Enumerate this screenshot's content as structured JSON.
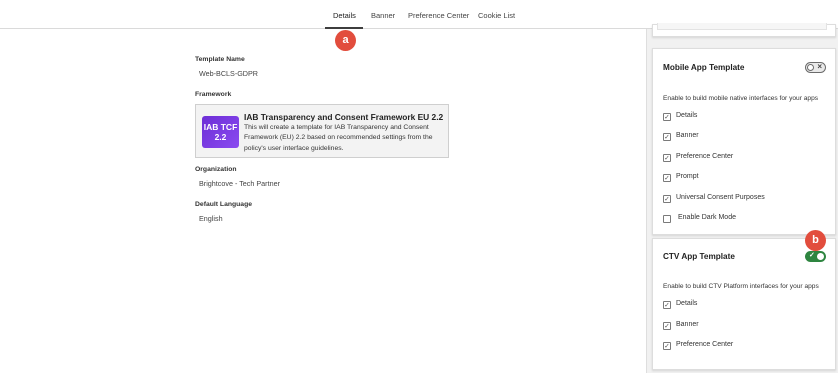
{
  "tabs": [
    {
      "label": "Details",
      "active": true
    },
    {
      "label": "Banner",
      "active": false
    },
    {
      "label": "Preference Center",
      "active": false
    },
    {
      "label": "Cookie List",
      "active": false
    }
  ],
  "markers": {
    "a": "a",
    "b": "b"
  },
  "details": {
    "template_name_label": "Template Name",
    "template_name_value": "Web-BCLS-GDPR",
    "framework_label": "Framework",
    "framework": {
      "logo_line1": "IAB TCF",
      "logo_line2": "2.2",
      "title": "IAB Transparency and Consent Framework EU 2.2",
      "description": "This will create a template for IAB Transparency and Consent Framework (EU) 2.2 based on recommended settings from the policy's user interface guidelines."
    },
    "organization_label": "Organization",
    "organization_value": "Brightcove - Tech Partner",
    "default_language_label": "Default Language",
    "default_language_value": "English"
  },
  "mobile_panel": {
    "title": "Mobile App Template",
    "toggle_on": false,
    "description": "Enable to build mobile native interfaces for your apps",
    "options": [
      {
        "label": "Details",
        "checked": true
      },
      {
        "label": "Banner",
        "checked": true
      },
      {
        "label": "Preference Center",
        "checked": true
      },
      {
        "label": "Prompt",
        "checked": true
      },
      {
        "label": "Universal Consent Purposes",
        "checked": true
      },
      {
        "label": "Enable Dark Mode",
        "checked": false
      }
    ]
  },
  "ctv_panel": {
    "title": "CTV App Template",
    "toggle_on": true,
    "description": "Enable to build CTV Platform interfaces for your apps",
    "options": [
      {
        "label": "Details",
        "checked": true
      },
      {
        "label": "Banner",
        "checked": true
      },
      {
        "label": "Preference Center",
        "checked": true
      }
    ]
  },
  "colors": {
    "accent_toggle_on": "#2e8540",
    "marker": "#e24d3d",
    "logo": "#7a3ae6"
  }
}
